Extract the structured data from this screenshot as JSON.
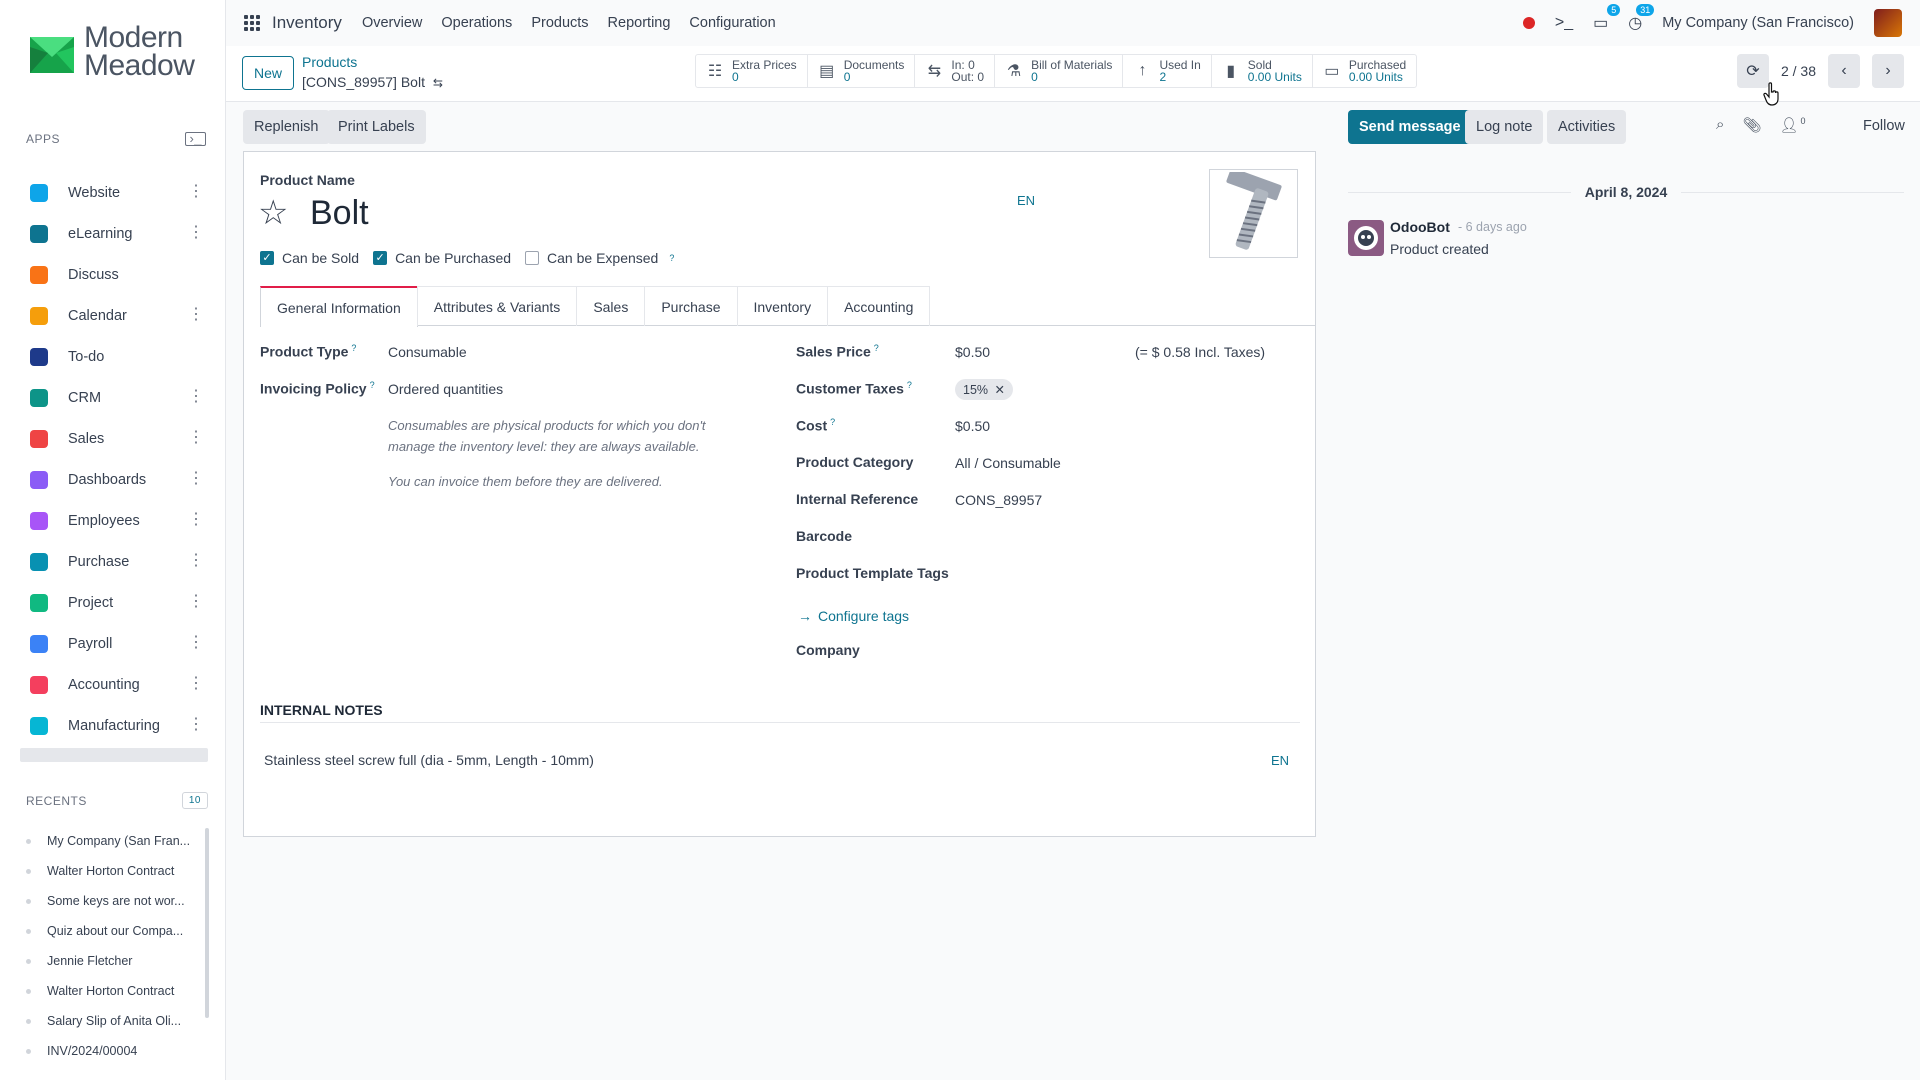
{
  "sidebar": {
    "logo_line1": "Modern",
    "logo_line2": "Meadow",
    "apps_label": "APPS",
    "apps": [
      {
        "label": "Website",
        "icon": "globe-icon",
        "color": "#0ea5e9",
        "more": true
      },
      {
        "label": "eLearning",
        "icon": "graduation-cap-icon",
        "color": "#0e7490",
        "more": true
      },
      {
        "label": "Discuss",
        "icon": "chat-bubble-icon",
        "color": "#f97316",
        "more": false
      },
      {
        "label": "Calendar",
        "icon": "calendar-icon",
        "color": "#f59e0b",
        "more": true
      },
      {
        "label": "To-do",
        "icon": "pencil-icon",
        "color": "#1e3a8a",
        "more": false
      },
      {
        "label": "CRM",
        "icon": "handshake-icon",
        "color": "#0d9488",
        "more": true
      },
      {
        "label": "Sales",
        "icon": "bar-chart-icon",
        "color": "#ef4444",
        "more": true
      },
      {
        "label": "Dashboards",
        "icon": "dashboard-icon",
        "color": "#8b5cf6",
        "more": true
      },
      {
        "label": "Employees",
        "icon": "people-icon",
        "color": "#a855f7",
        "more": true
      },
      {
        "label": "Purchase",
        "icon": "credit-card-icon",
        "color": "#0891b2",
        "more": true
      },
      {
        "label": "Project",
        "icon": "check-icon",
        "color": "#10b981",
        "more": true
      },
      {
        "label": "Payroll",
        "icon": "wallet-icon",
        "color": "#3b82f6",
        "more": true
      },
      {
        "label": "Accounting",
        "icon": "tools-icon",
        "color": "#f43f5e",
        "more": true
      },
      {
        "label": "Manufacturing",
        "icon": "factory-icon",
        "color": "#06b6d4",
        "more": true
      }
    ],
    "recents_label": "RECENTS",
    "recents_count": "10",
    "recents": [
      "My Company (San Fran...",
      "Walter Horton Contract",
      "Some keys are not wor...",
      "Quiz about our Compa...",
      "Jennie Fletcher",
      "Walter Horton Contract",
      "Salary Slip of Anita Oli...",
      "INV/2024/00004"
    ]
  },
  "topnav": {
    "app_title": "Inventory",
    "items": [
      "Overview",
      "Operations",
      "Products",
      "Reporting",
      "Configuration"
    ],
    "messages_count": "5",
    "activities_count": "31",
    "company": "My Company (San Francisco)"
  },
  "control": {
    "new_label": "New",
    "breadcrumb_parent": "Products",
    "breadcrumb_current": "[CONS_89957] Bolt",
    "stats": [
      {
        "label": "Extra Prices",
        "value": "0",
        "icon": "list-icon"
      },
      {
        "label": "Documents",
        "value": "0",
        "icon": "document-icon"
      },
      {
        "label": "In: 0",
        "value": "Out: 0",
        "icon": "arrows-exchange-icon"
      },
      {
        "label": "Bill of Materials",
        "value": "0",
        "icon": "flask-icon"
      },
      {
        "label": "Used In",
        "value": "2",
        "icon": "arrow-up-icon"
      },
      {
        "label": "Sold",
        "value": "0.00 Units",
        "icon": "bar-chart-icon"
      },
      {
        "label": "Purchased",
        "value": "0.00 Units",
        "icon": "credit-card-icon"
      }
    ],
    "pager": "2 / 38"
  },
  "actions": {
    "replenish": "Replenish",
    "print_labels": "Print Labels"
  },
  "form": {
    "name_label": "Product Name",
    "name": "Bolt",
    "lang": "EN",
    "can_be_sold": "Can be Sold",
    "can_be_purchased": "Can be Purchased",
    "can_be_expensed": "Can be Expensed",
    "tabs": [
      "General Information",
      "Attributes & Variants",
      "Sales",
      "Purchase",
      "Inventory",
      "Accounting"
    ],
    "product_type_label": "Product Type",
    "product_type": "Consumable",
    "invoicing_policy_label": "Invoicing Policy",
    "invoicing_policy": "Ordered quantities",
    "note1": "Consumables are physical products for which you don't manage the inventory level: they are always available.",
    "note2": "You can invoice them before they are delivered.",
    "sales_price_label": "Sales Price",
    "sales_price": "$0.50",
    "incl_taxes": "(= $ 0.58 Incl. Taxes)",
    "customer_taxes_label": "Customer Taxes",
    "customer_tax_tag": "15%",
    "cost_label": "Cost",
    "cost": "$0.50",
    "category_label": "Product Category",
    "category": "All / Consumable",
    "internal_ref_label": "Internal Reference",
    "internal_ref": "CONS_89957",
    "barcode_label": "Barcode",
    "tags_label": "Product Template Tags",
    "configure_tags": "Configure tags",
    "company_label": "Company",
    "internal_notes_label": "INTERNAL NOTES",
    "internal_notes": "Stainless steel screw full (dia - 5mm, Length - 10mm)"
  },
  "chatter": {
    "send_message": "Send message",
    "log_note": "Log note",
    "activities": "Activities",
    "followers_count": "0",
    "follow": "Follow",
    "date": "April 8, 2024",
    "author": "OdooBot",
    "time": "- 6 days ago",
    "body": "Product created"
  }
}
